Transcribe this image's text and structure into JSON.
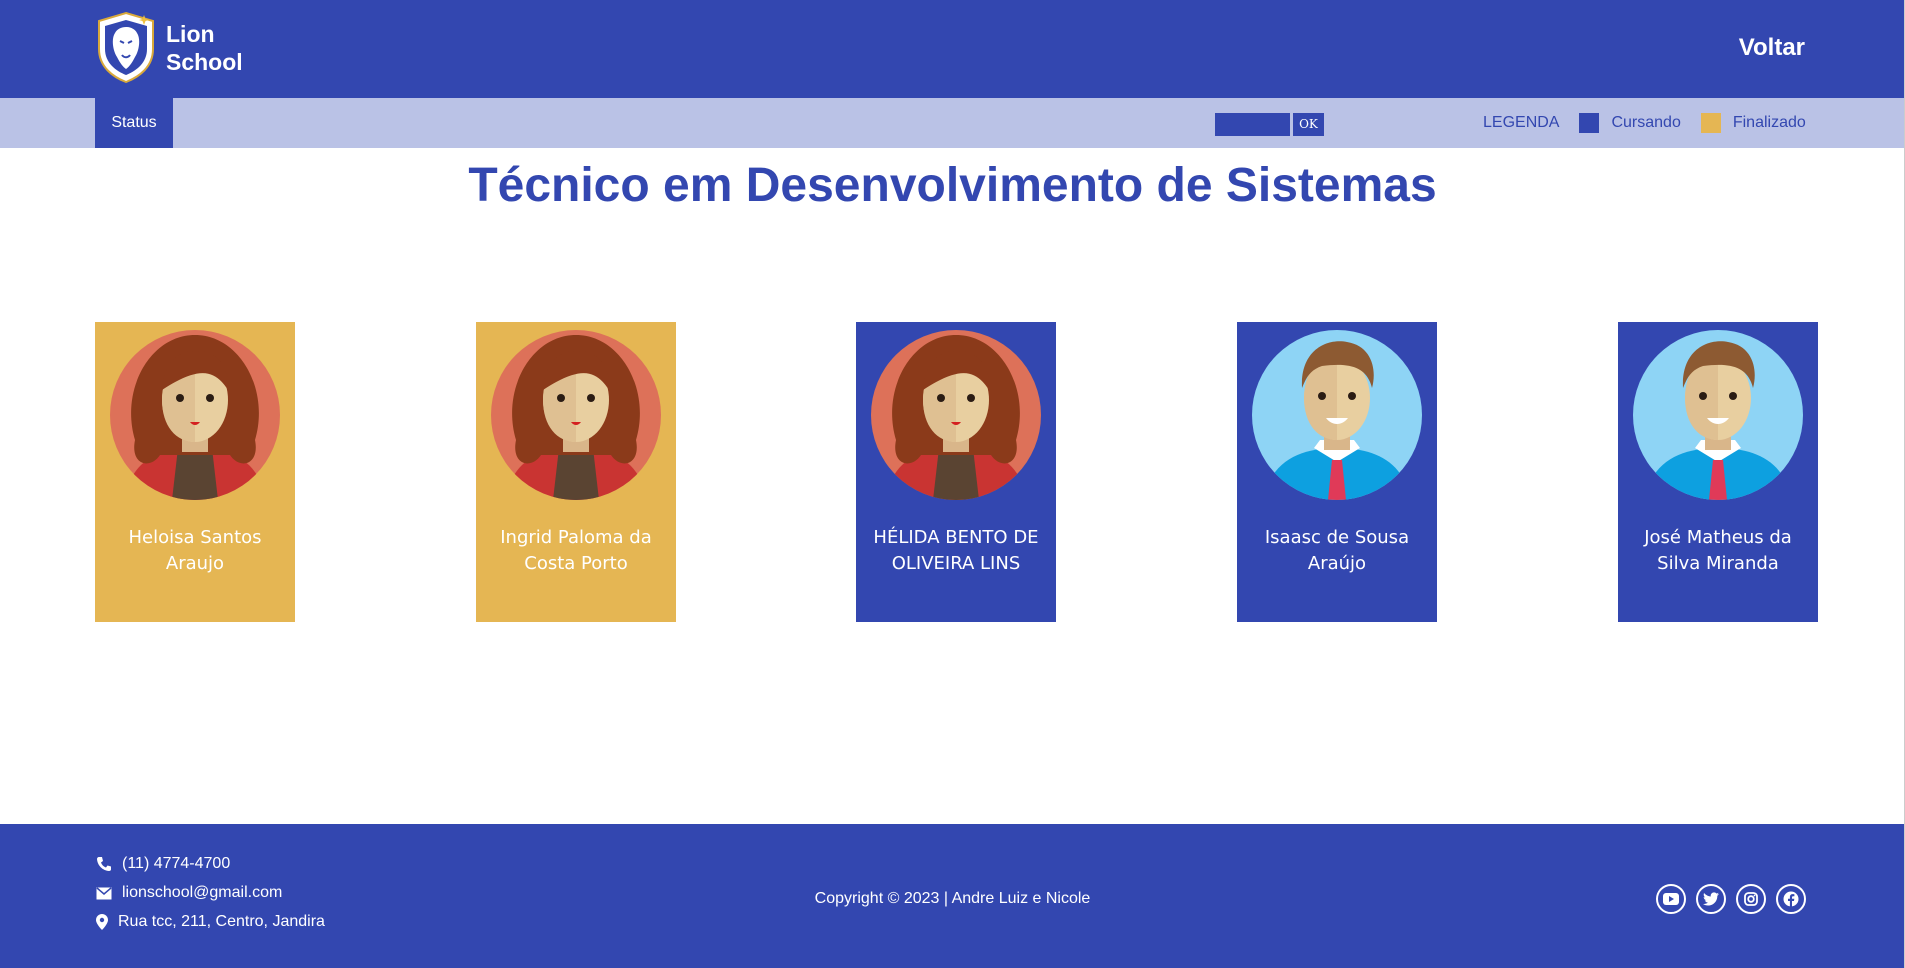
{
  "header": {
    "logo_line1": "Lion",
    "logo_line2": "School",
    "back_label": "Voltar"
  },
  "subbar": {
    "status_tab": "Status",
    "filter_placeholder": "",
    "ok_label": "OK",
    "legend_title": "LEGENDA",
    "legend_items": [
      {
        "label": "Cursando",
        "color": "#3347B0"
      },
      {
        "label": "Finalizado",
        "color": "#E5B653"
      }
    ]
  },
  "page_title": "Técnico em Desenvolvimento de Sistemas",
  "students": [
    {
      "name": "Heloisa Santos Araujo",
      "status": "Finalizado",
      "avatar": "female-avatar-icon"
    },
    {
      "name": "Ingrid Paloma da Costa Porto",
      "status": "Finalizado",
      "avatar": "female-avatar-icon"
    },
    {
      "name": "HÉLIDA BENTO DE OLIVEIRA LINS",
      "status": "Cursando",
      "avatar": "female-avatar-icon"
    },
    {
      "name": "Isaasc de Sousa Araújo",
      "status": "Cursando",
      "avatar": "male-avatar-icon"
    },
    {
      "name": "José Matheus da Silva Miranda",
      "status": "Cursando",
      "avatar": "male-avatar-icon"
    }
  ],
  "footer": {
    "phone": "(11) 4774-4700",
    "email": "lionschool@gmail.com",
    "address": "Rua tcc, 211, Centro, Jandira",
    "copyright": "Copyright © 2023 | Andre Luiz e Nicole",
    "socials": [
      "youtube-icon",
      "twitter-icon",
      "instagram-icon",
      "facebook-icon"
    ]
  },
  "colors": {
    "primary": "#3347B0",
    "subbar": "#BAC2E6",
    "finished": "#E5B653"
  }
}
